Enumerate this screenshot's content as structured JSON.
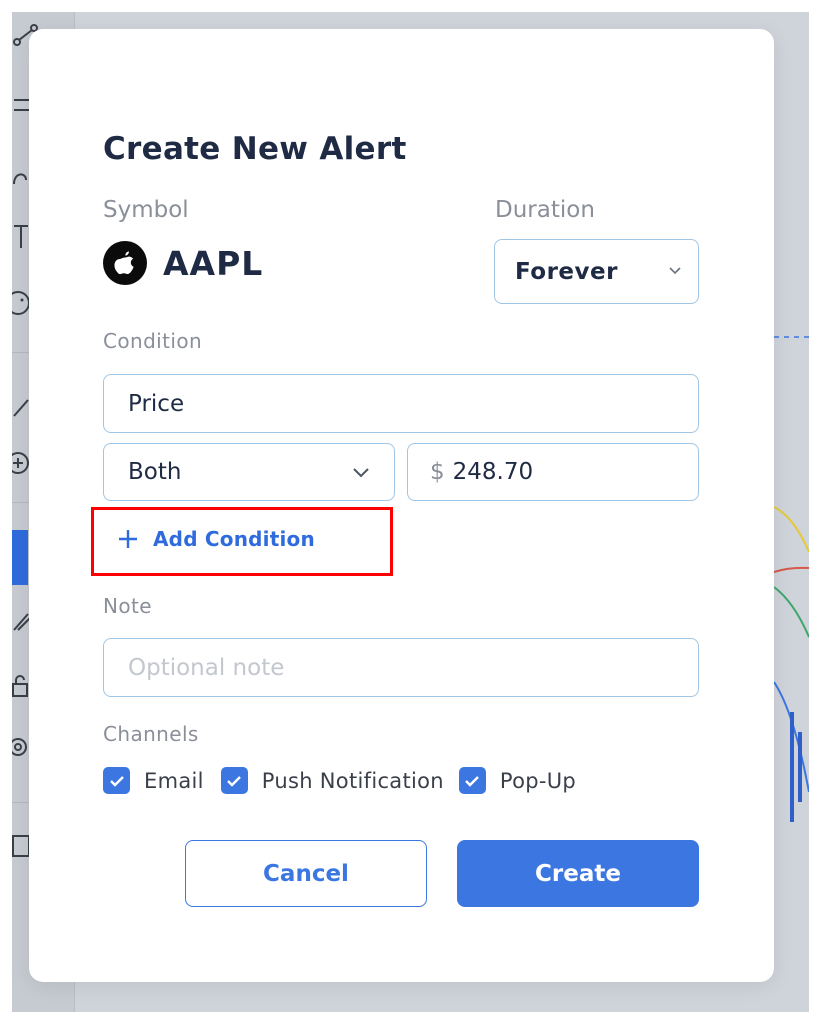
{
  "modal": {
    "title": "Create New Alert",
    "symbol_label": "Symbol",
    "symbol_value": "AAPL",
    "duration_label": "Duration",
    "duration_value": "Forever",
    "condition_label": "Condition",
    "condition_source": "Price",
    "condition_operator": "Both",
    "price_currency": "$",
    "price_value": "248.70",
    "add_condition_label": "Add Condition",
    "note_label": "Note",
    "note_placeholder": "Optional note",
    "channels_label": "Channels",
    "channels": [
      {
        "label": "Email",
        "checked": true
      },
      {
        "label": "Push Notification",
        "checked": true
      },
      {
        "label": "Pop-Up",
        "checked": true
      }
    ],
    "cancel_label": "Cancel",
    "create_label": "Create"
  },
  "colors": {
    "accent": "#3b76e1",
    "title": "#1f2a44",
    "highlight": "#ff0000"
  },
  "icons": [
    "apple-logo-icon",
    "chevron-down-icon",
    "plus-icon",
    "check-icon"
  ]
}
